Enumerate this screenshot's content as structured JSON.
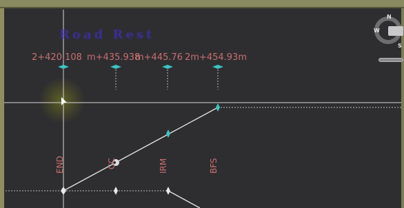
{
  "road_name": "Road Rest",
  "chainage_labels": [
    "2+420.108",
    "m+435.938",
    "m+445.76",
    "2m+454.93m"
  ],
  "vertical_tags": [
    "END",
    "CC",
    "IRM",
    "BFS"
  ],
  "compass": {
    "north": "N",
    "west": "W",
    "south": "S"
  },
  "colors": {
    "background": "#2e2e31",
    "label_red": "#c86e6e",
    "marker_cyan": "#3ec3c3",
    "title_blue": "#3d2fa8"
  },
  "icons": [
    "cursor-arrow-icon",
    "compass-icon",
    "zoom-slider-icon"
  ]
}
